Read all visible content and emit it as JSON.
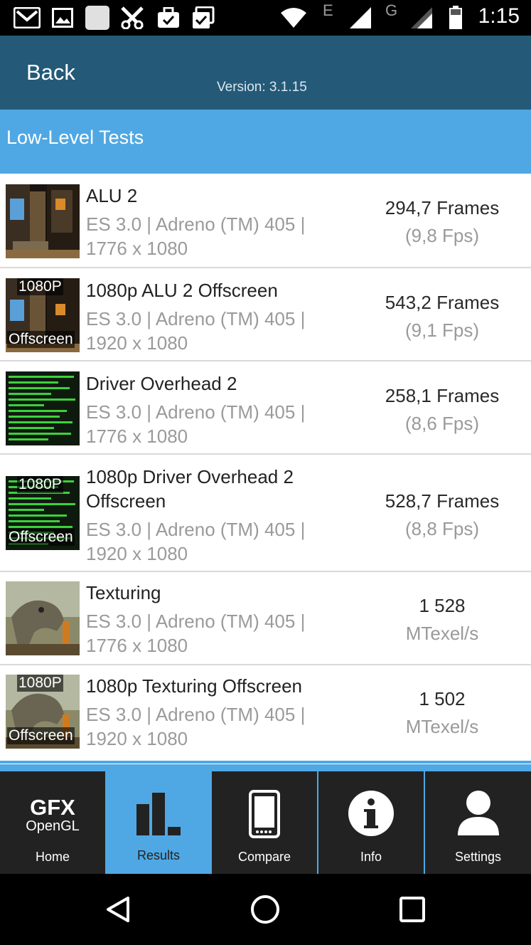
{
  "status_bar": {
    "time": "1:15",
    "network_label_1": "E",
    "network_label_2": "G",
    "icons": [
      "gmail-icon",
      "image-icon",
      "app-icon",
      "tools-icon",
      "briefcase-check-icon",
      "clipboard-check-icon",
      "wifi-icon",
      "signal-icon",
      "signal-icon",
      "battery-icon"
    ]
  },
  "header": {
    "back_label": "Back",
    "version": "Version: 3.1.15"
  },
  "section": {
    "title": "Low-Level Tests"
  },
  "tests": [
    {
      "name": "ALU 2",
      "line1": "ES 3.0 | Adreno (TM) 405 |",
      "line2": "1776 x 1080",
      "score": "294,7 Frames",
      "sub": "(9,8 Fps)",
      "thumb": "alu",
      "badge_top": "",
      "badge_bottom": ""
    },
    {
      "name": "1080p ALU 2 Offscreen",
      "line1": "ES 3.0 | Adreno (TM) 405 |",
      "line2": "1920 x 1080",
      "score": "543,2 Frames",
      "sub": "(9,1 Fps)",
      "thumb": "alu",
      "badge_top": "1080P",
      "badge_bottom": "Offscreen"
    },
    {
      "name": "Driver Overhead 2",
      "line1": "ES 3.0 | Adreno (TM) 405 |",
      "line2": "1776 x 1080",
      "score": "258,1 Frames",
      "sub": "(8,6 Fps)",
      "thumb": "driver",
      "badge_top": "",
      "badge_bottom": ""
    },
    {
      "name_line1": "1080p Driver Overhead 2",
      "name_line2": "Offscreen",
      "line1": "ES 3.0 | Adreno (TM) 405 |",
      "line2": "1920 x 1080",
      "score": "528,7 Frames",
      "sub": "(8,8 Fps)",
      "thumb": "driver",
      "badge_top": "1080P",
      "badge_bottom": "Offscreen"
    },
    {
      "name": "Texturing",
      "line1": "ES 3.0 | Adreno (TM) 405 |",
      "line2": "1776 x 1080",
      "score": "1 528",
      "sub": "MTexel/s",
      "thumb": "texture",
      "badge_top": "",
      "badge_bottom": ""
    },
    {
      "name": "1080p Texturing Offscreen",
      "line1": "ES 3.0 | Adreno (TM) 405 |",
      "line2": "1920 x 1080",
      "score": "1 502",
      "sub": "MTexel/s",
      "thumb": "texture",
      "badge_top": "1080P",
      "badge_bottom": "Offscreen"
    }
  ],
  "tabs": [
    {
      "label": "Home",
      "logo_top": "GFX",
      "logo_bottom": "OpenGL",
      "icon": "gfx-logo-icon"
    },
    {
      "label": "Results",
      "icon": "bar-chart-icon",
      "active": true
    },
    {
      "label": "Compare",
      "icon": "phone-icon"
    },
    {
      "label": "Info",
      "icon": "info-icon"
    },
    {
      "label": "Settings",
      "icon": "user-icon"
    }
  ],
  "colors": {
    "header": "#245a78",
    "accent": "#4fa8e3",
    "tab_bg": "#222222"
  }
}
